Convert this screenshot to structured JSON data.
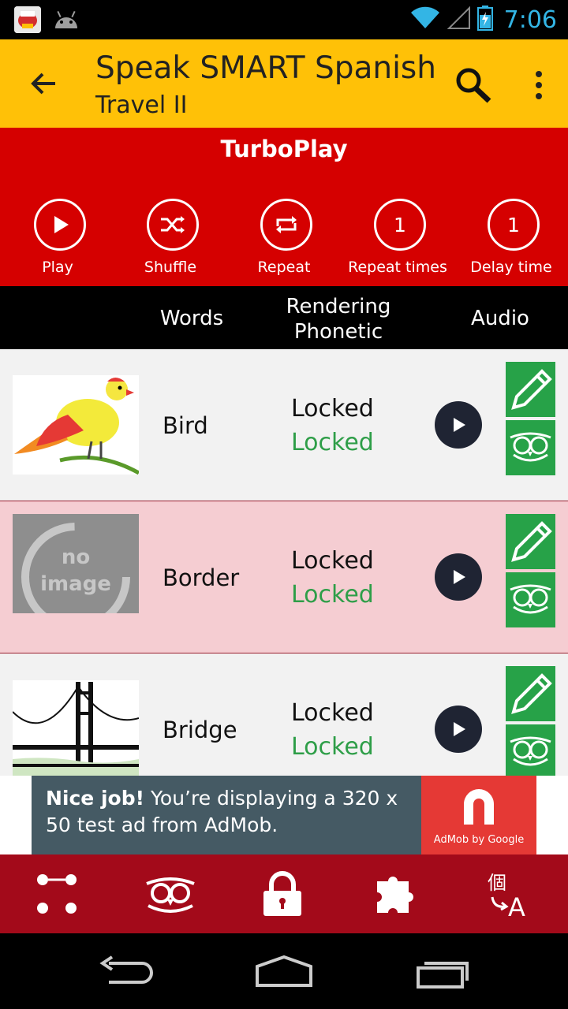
{
  "status_bar": {
    "time": "7:06"
  },
  "app_bar": {
    "title": "Speak SMART Spanish",
    "subtitle": "Travel II"
  },
  "turbo": {
    "title": "TurboPlay",
    "controls": [
      {
        "label": "Play",
        "icon": "play-icon"
      },
      {
        "label": "Shuffle",
        "icon": "shuffle-icon"
      },
      {
        "label": "Repeat",
        "icon": "repeat-icon"
      },
      {
        "label": "Repeat times",
        "value": "1"
      },
      {
        "label": "Delay time",
        "value": "1"
      }
    ]
  },
  "columns": {
    "words": "Words",
    "rendering": "Rendering",
    "phonetic": "Phonetic",
    "audio": "Audio"
  },
  "rows": [
    {
      "word": "Bird",
      "rendering": "Locked",
      "phonetic": "Locked",
      "image": "bird-image"
    },
    {
      "word": "Border",
      "rendering": "Locked",
      "phonetic": "Locked",
      "image": "no-image-placeholder",
      "no_image_line1": "no",
      "no_image_line2": "image"
    },
    {
      "word": "Bridge",
      "rendering": "Locked",
      "phonetic": "Locked",
      "image": "bridge-image"
    }
  ],
  "ad": {
    "bold": "Nice job!",
    "text": " You’re displaying a 320 x 50 test ad from AdMob.",
    "brand": "AdMob by Google"
  },
  "bottom_bar": {
    "icons": [
      "dots-icon",
      "owl-icon",
      "lock-icon",
      "puzzle-icon",
      "translate-icon"
    ]
  },
  "colors": {
    "app_bar": "#ffc107",
    "turbo": "#d50000",
    "accent_green": "#27a248",
    "bottom_bar": "#a30a1a",
    "highlight_row": "#f5cdd2"
  }
}
